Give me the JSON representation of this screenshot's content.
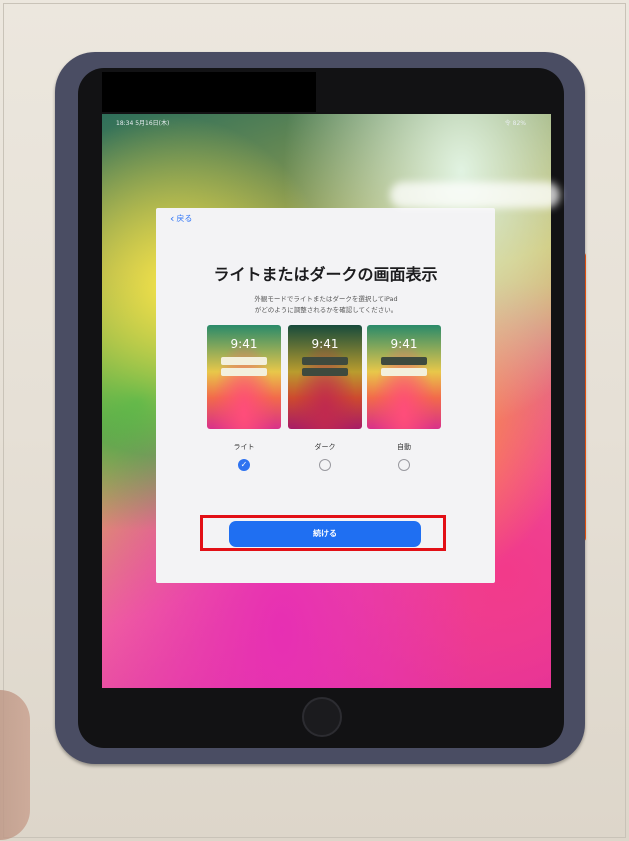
{
  "status_bar": {
    "time_date": "18:34 5月16日(木)",
    "right": "令 82%"
  },
  "dialog": {
    "back_label": "戻る",
    "title": "ライトまたはダークの画面表示",
    "description_line1": "外観モードでライトまたはダークを選択してiPad",
    "description_line2": "がどのように調整されるかを確認してください。",
    "previews": [
      {
        "time": "9:41",
        "label": "ライト",
        "selected": true
      },
      {
        "time": "9:41",
        "label": "ダーク",
        "selected": false
      },
      {
        "time": "9:41",
        "label": "自動",
        "selected": false
      }
    ],
    "continue_label": "続ける"
  },
  "icons": {
    "back": "chevron-left-icon",
    "selected": "checkmark-icon"
  },
  "colors": {
    "accent": "#1f6ff2",
    "highlight": "#e20f16"
  }
}
